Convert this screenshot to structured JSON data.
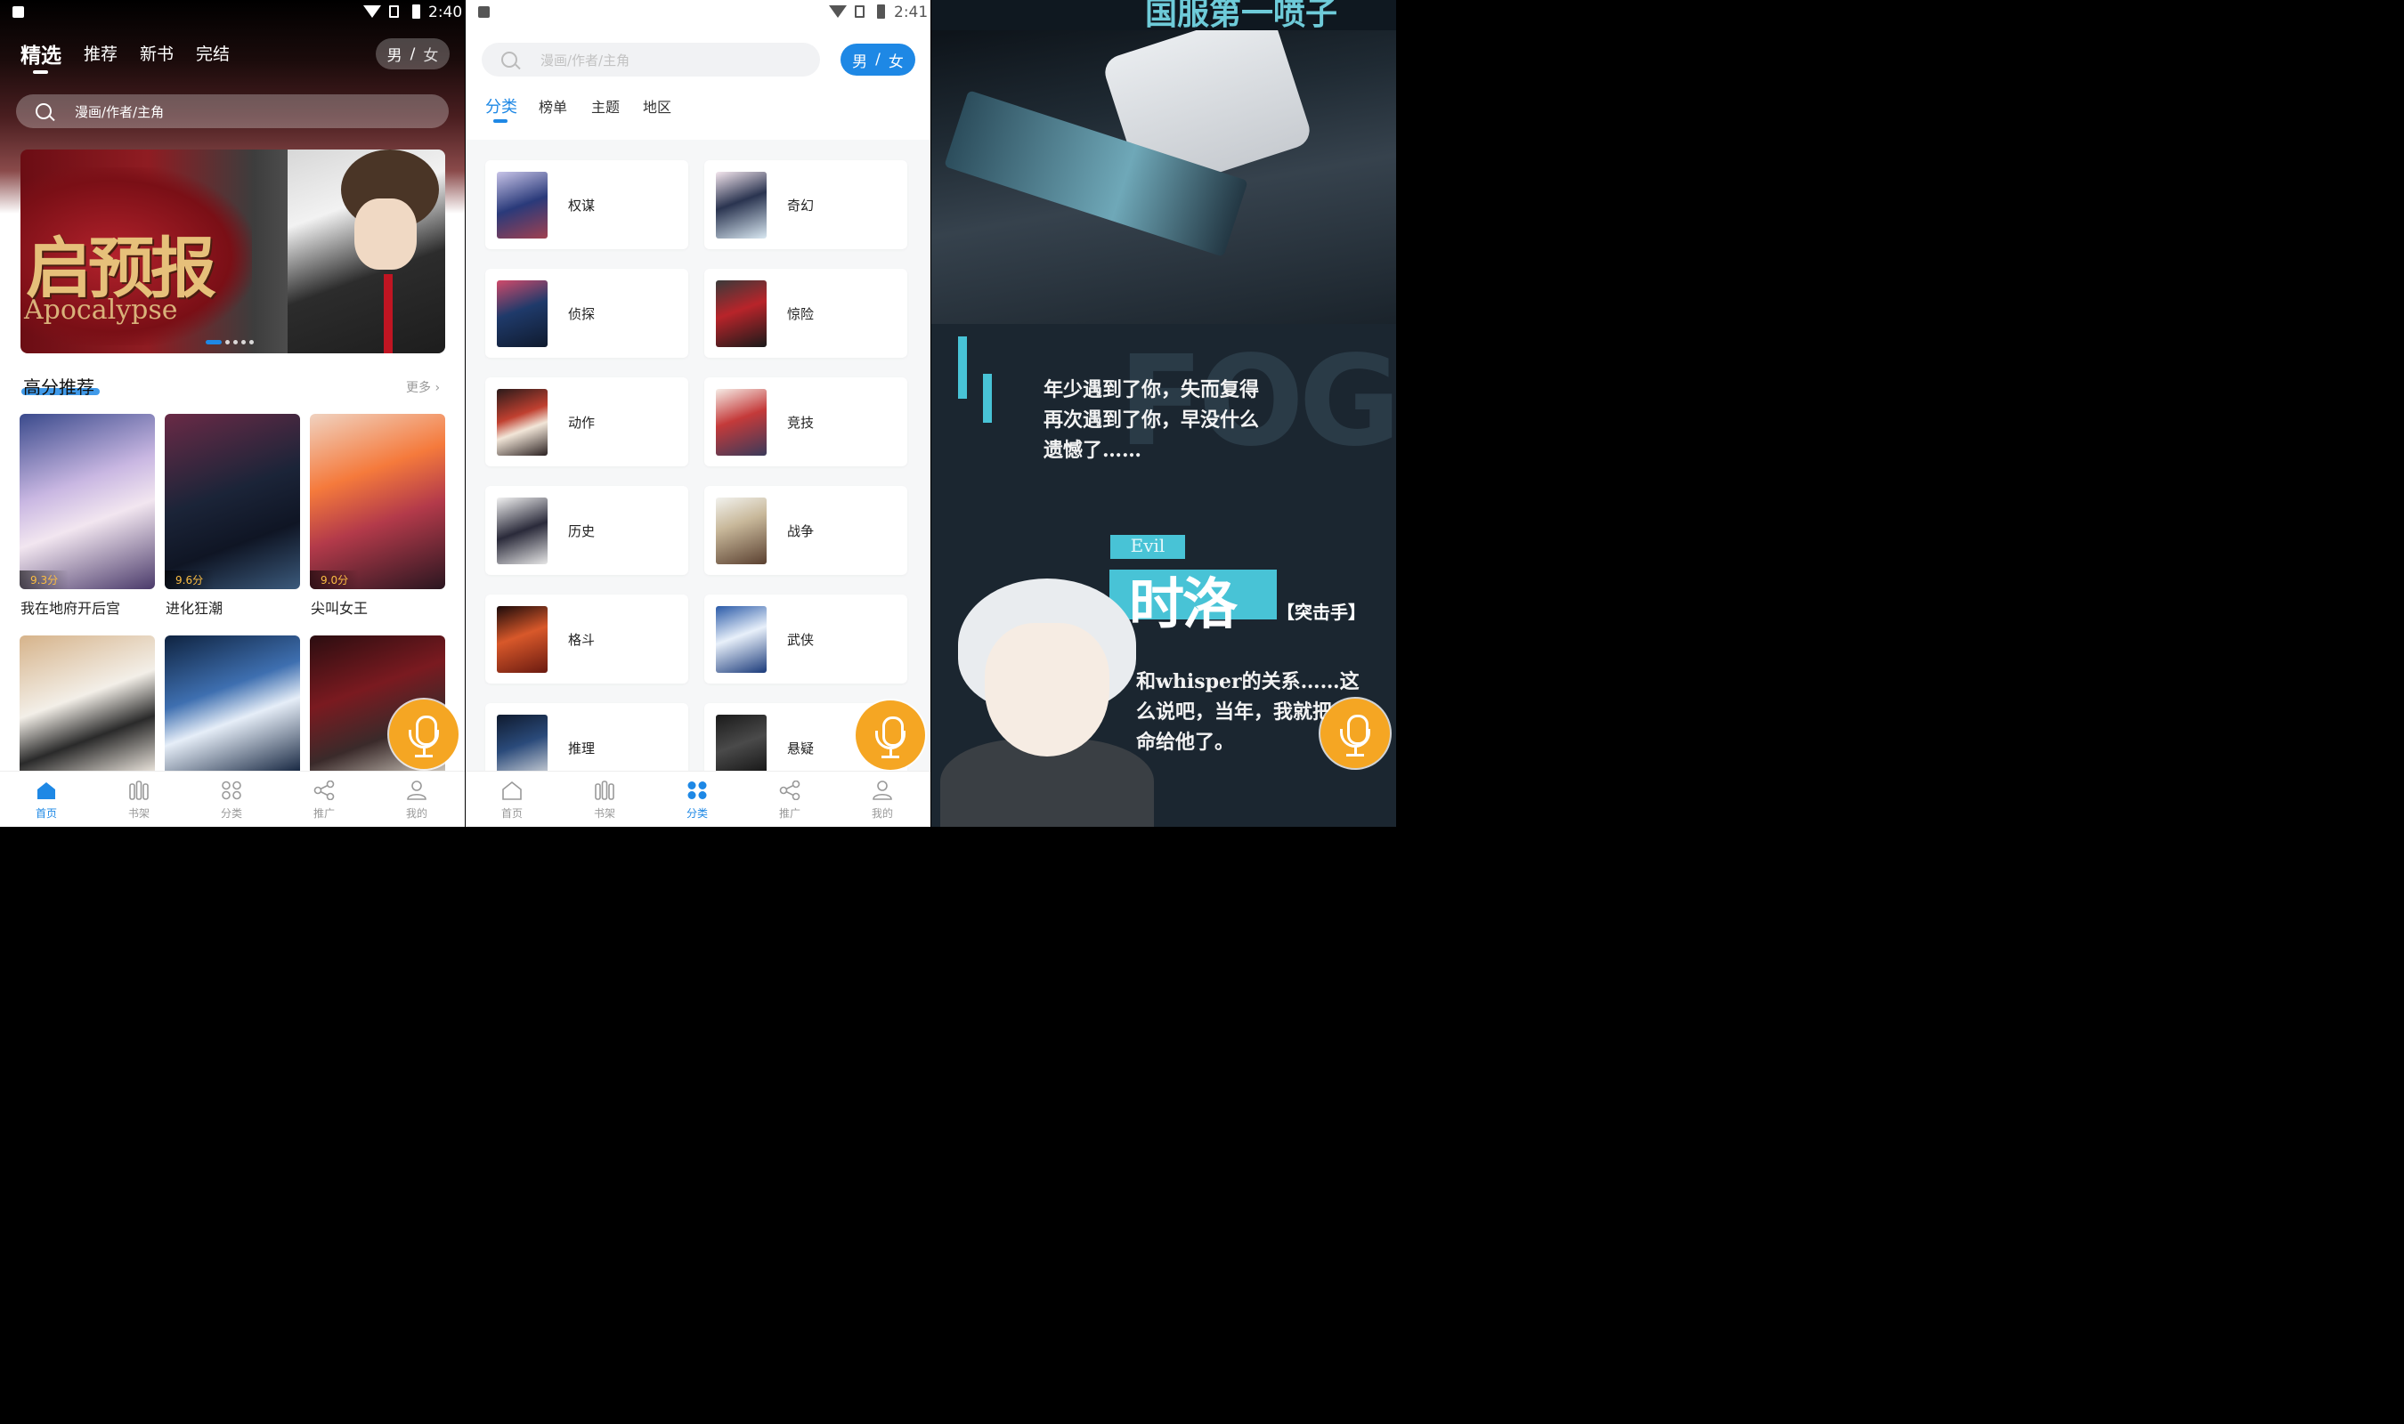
{
  "screen1": {
    "status": {
      "time": "2:40"
    },
    "tabs": [
      "精选",
      "推荐",
      "新书",
      "完结"
    ],
    "gender": {
      "male": "男",
      "sep": "/",
      "female": "女"
    },
    "search_placeholder": "漫画/作者/主角",
    "banner": {
      "title": "启预报",
      "subtitle": "Apocalypse",
      "dots": 5,
      "active_dot": 0
    },
    "section": {
      "title": "高分推荐",
      "more": "更多 ›"
    },
    "comics": [
      {
        "title": "我在地府开后宫",
        "score": "9.3分"
      },
      {
        "title": "进化狂潮",
        "score": "9.6分"
      },
      {
        "title": "尖叫女王",
        "score": "9.0分"
      }
    ],
    "comics_row2": [
      "",
      "",
      ""
    ]
  },
  "screen2": {
    "status": {
      "time": "2:41"
    },
    "search_placeholder": "漫画/作者/主角",
    "gender": {
      "male": "男",
      "sep": "/",
      "female": "女"
    },
    "tabs": [
      "分类",
      "榜单",
      "主题",
      "地区"
    ],
    "categories": [
      "权谋",
      "奇幻",
      "侦探",
      "惊险",
      "动作",
      "竞技",
      "历史",
      "战争",
      "格斗",
      "武侠",
      "推理",
      "悬疑"
    ]
  },
  "screen3": {
    "top_title": "国服第一喷子",
    "quote_lines": [
      "年少遇到了你，失而复得",
      "再次遇到了你，早没什么",
      "遗憾了……"
    ],
    "bg_word": "FOG",
    "tag": "Evil",
    "name": "时洛",
    "role": "【突击手】",
    "desc_lines": [
      "和whisper的关系……这",
      "么说吧，当年，我就把",
      "命给他了。"
    ]
  },
  "bottom_nav": [
    "首页",
    "书架",
    "分类",
    "推广",
    "我的"
  ],
  "colors": {
    "accent": "#1e88e5",
    "mic": "#f5a623",
    "score": "#fbbd43",
    "cyan": "#48c3d6"
  }
}
